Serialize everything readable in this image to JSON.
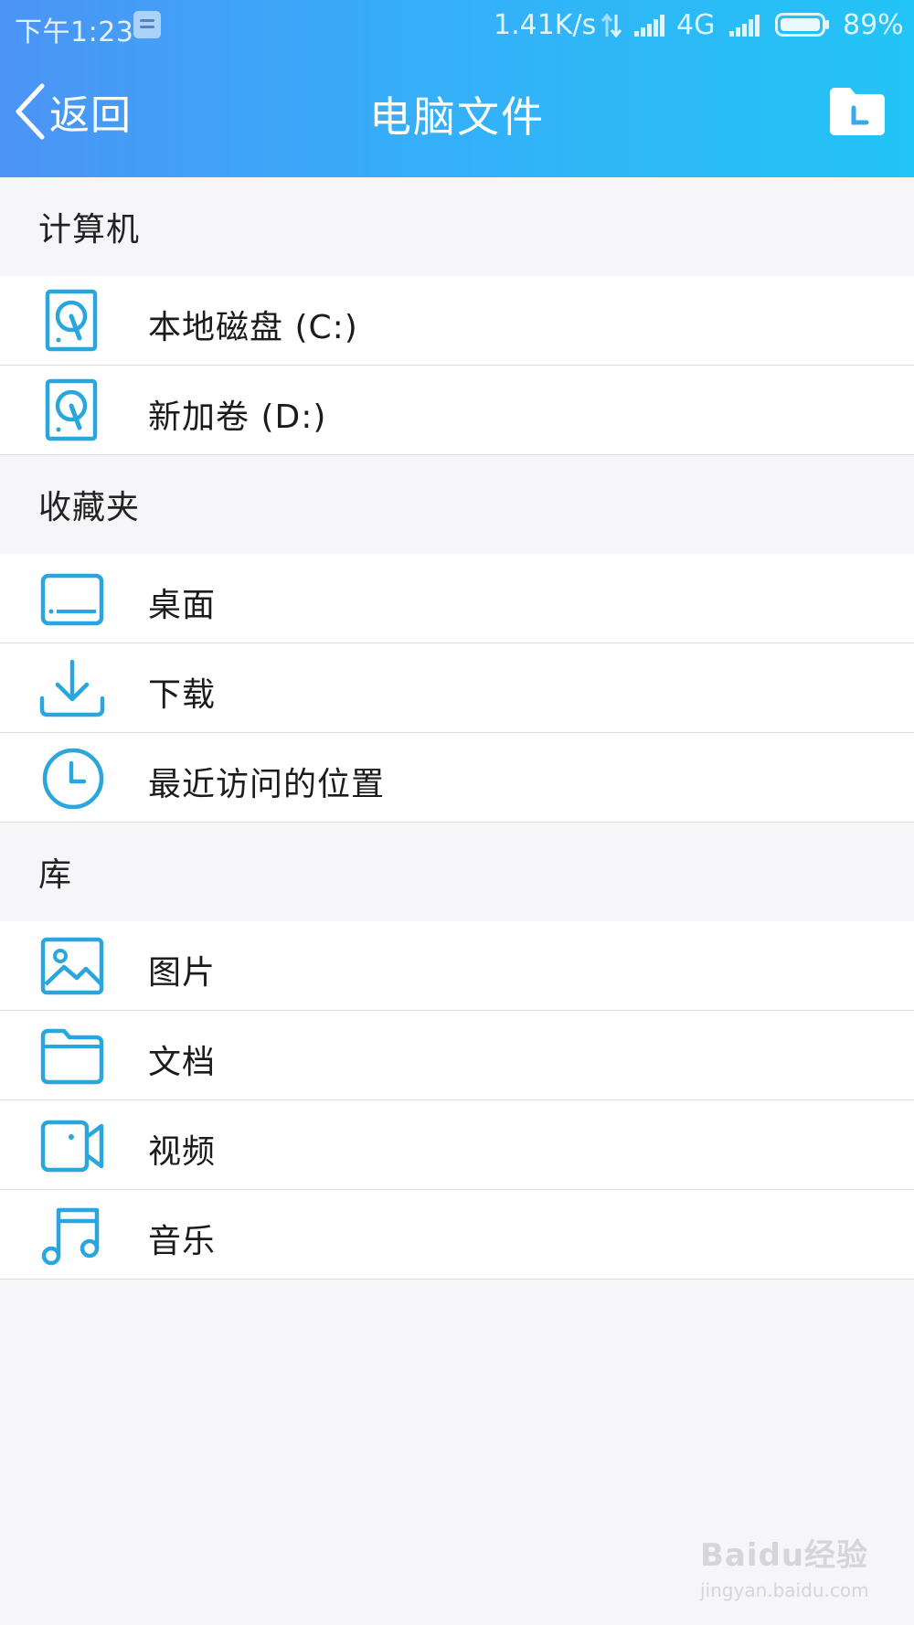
{
  "status_bar": {
    "time": "下午1:23",
    "net_speed": "1.41K/s",
    "network": "4G",
    "battery": "89%"
  },
  "nav": {
    "back_label": "返回",
    "title": "电脑文件"
  },
  "sections": {
    "computer": {
      "title": "计算机",
      "items": [
        {
          "label": "本地磁盘 (C:)",
          "icon": "disk-icon"
        },
        {
          "label": "新加卷 (D:)",
          "icon": "disk-icon"
        }
      ]
    },
    "favorites": {
      "title": "收藏夹",
      "items": [
        {
          "label": "桌面",
          "icon": "desktop-icon"
        },
        {
          "label": "下载",
          "icon": "download-icon"
        },
        {
          "label": "最近访问的位置",
          "icon": "clock-icon"
        }
      ]
    },
    "library": {
      "title": "库",
      "items": [
        {
          "label": "图片",
          "icon": "image-icon"
        },
        {
          "label": "文档",
          "icon": "folder-icon"
        },
        {
          "label": "视频",
          "icon": "video-icon"
        },
        {
          "label": "音乐",
          "icon": "music-icon"
        }
      ]
    }
  },
  "watermark": {
    "brand": "Baidu经验",
    "url": "jingyan.baidu.com"
  },
  "colors": {
    "header_start": "#4c94f6",
    "header_end": "#23c4f6",
    "icon": "#2aa6de",
    "background": "#f6f6f8"
  }
}
